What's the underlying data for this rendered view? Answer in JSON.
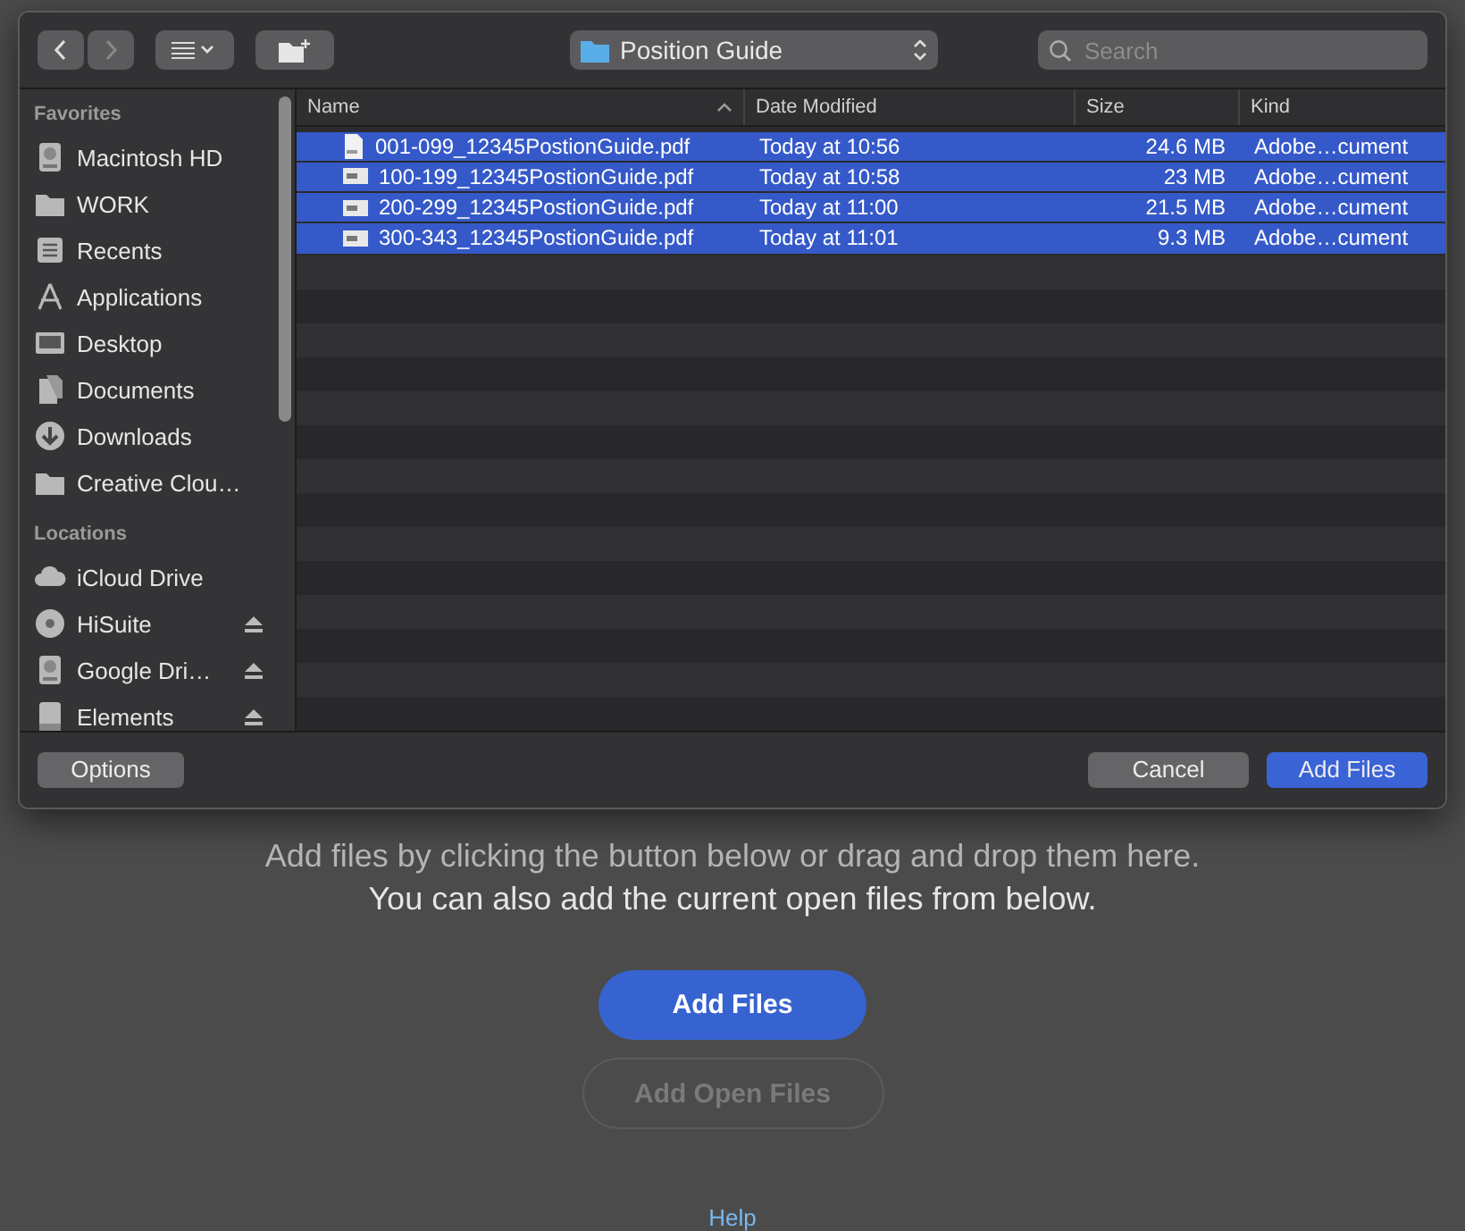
{
  "dialog": {
    "toolbar": {
      "location": "Position Guide",
      "search": {
        "placeholder": "Search"
      }
    },
    "sidebar": {
      "sections": [
        {
          "title": "Favorites",
          "items": [
            {
              "label": "Macintosh HD",
              "kind": "disk",
              "eject": false
            },
            {
              "label": "WORK",
              "kind": "folder",
              "eject": false
            },
            {
              "label": "Recents",
              "kind": "recents",
              "eject": false
            },
            {
              "label": "Applications",
              "kind": "apps",
              "eject": false
            },
            {
              "label": "Desktop",
              "kind": "desktop",
              "eject": false
            },
            {
              "label": "Documents",
              "kind": "documents",
              "eject": false
            },
            {
              "label": "Downloads",
              "kind": "downloads",
              "eject": false
            },
            {
              "label": "Creative Clou…",
              "kind": "folder",
              "eject": false
            }
          ]
        },
        {
          "title": "Locations",
          "items": [
            {
              "label": "iCloud Drive",
              "kind": "cloud",
              "eject": false
            },
            {
              "label": "HiSuite",
              "kind": "disc",
              "eject": true
            },
            {
              "label": "Google Dri…",
              "kind": "disk",
              "eject": true
            },
            {
              "label": "Elements",
              "kind": "drive",
              "eject": true
            }
          ]
        }
      ]
    },
    "table": {
      "columns": [
        {
          "label": "Name",
          "sorted": true
        },
        {
          "label": "Date Modified",
          "sorted": false
        },
        {
          "label": "Size",
          "sorted": false
        },
        {
          "label": "Kind",
          "sorted": false
        }
      ],
      "rows": [
        {
          "name": "001-099_12345PostionGuide.pdf",
          "date": "Today at 10:56",
          "size": "24.6 MB",
          "kind": "Adobe…cument",
          "selected": true
        },
        {
          "name": "100-199_12345PostionGuide.pdf",
          "date": "Today at 10:58",
          "size": "23 MB",
          "kind": "Adobe…cument",
          "selected": true
        },
        {
          "name": "200-299_12345PostionGuide.pdf",
          "date": "Today at 11:00",
          "size": "21.5 MB",
          "kind": "Adobe…cument",
          "selected": true
        },
        {
          "name": "300-343_12345PostionGuide.pdf",
          "date": "Today at 11:01",
          "size": "9.3 MB",
          "kind": "Adobe…cument",
          "selected": true
        }
      ]
    },
    "buttons": {
      "options": "Options",
      "cancel": "Cancel",
      "confirm": "Add Files"
    }
  },
  "page": {
    "hint": "Add files by clicking the button below or drag and drop them here.",
    "hint_2": "You can also add the current open files from below.",
    "add_files": "Add Files",
    "add_open_files": {
      "label": "Add Open Files",
      "disabled": true
    },
    "help": "Help"
  }
}
